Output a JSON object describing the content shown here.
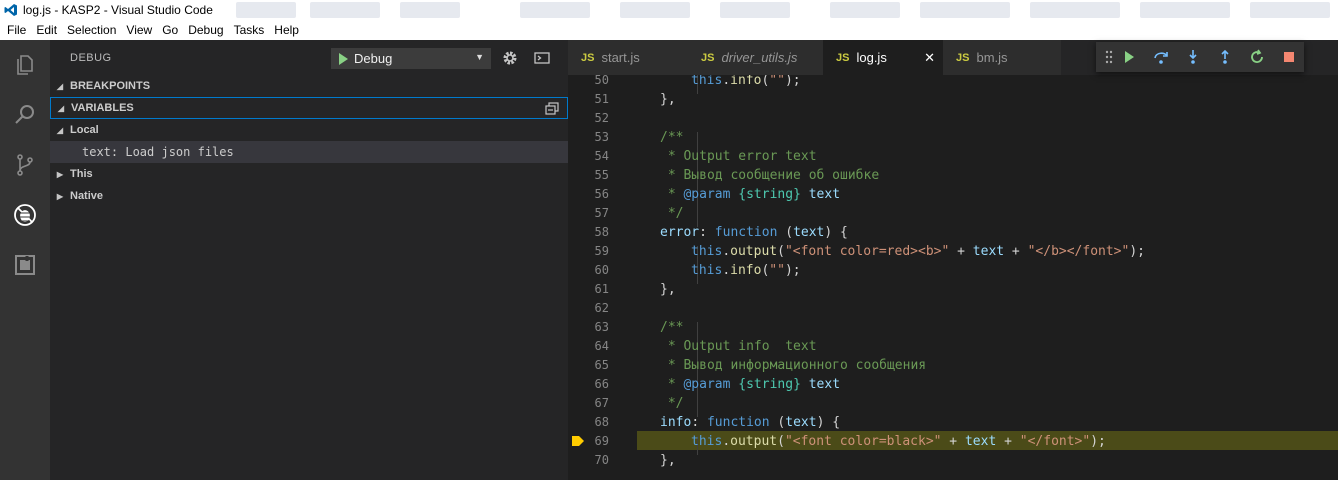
{
  "window": {
    "title": "log.js - KASP2 - Visual Studio Code"
  },
  "menu": [
    "File",
    "Edit",
    "Selection",
    "View",
    "Go",
    "Debug",
    "Tasks",
    "Help"
  ],
  "activity": [
    "explorer-icon",
    "search-icon",
    "source-control-icon",
    "debug-icon",
    "extensions-icon"
  ],
  "sidebar": {
    "title": "DEBUG",
    "config": "Debug",
    "sections": {
      "breakpoints": "BREAKPOINTS",
      "variables": "VARIABLES"
    },
    "scopes": {
      "local": "Local",
      "this": "This",
      "native": "Native"
    },
    "variable": "text: Load json files"
  },
  "tabs": [
    {
      "label": "start.js",
      "icon": "JS"
    },
    {
      "label": "driver_utils.js",
      "icon": "JS"
    },
    {
      "label": "log.js",
      "icon": "JS",
      "close": "✕"
    },
    {
      "label": "bm.js",
      "icon": "JS"
    }
  ],
  "debug_toolbar": [
    "grip-icon",
    "continue-icon",
    "step-over-icon",
    "step-into-icon",
    "step-out-icon",
    "restart-icon",
    "stop-icon"
  ],
  "editor": {
    "current_line": "69",
    "lines": [
      {
        "n": "50",
        "t": [
          [
            "this",
            "this"
          ],
          [
            "pl",
            "."
          ],
          [
            "fn",
            "info"
          ],
          [
            "pl",
            "("
          ],
          [
            "str",
            "\"\""
          ],
          [
            "pl",
            ");"
          ]
        ],
        "indent": 2
      },
      {
        "n": "51",
        "t": [
          [
            "pl",
            "},"
          ]
        ],
        "indent": 1
      },
      {
        "n": "52",
        "t": [],
        "indent": 0
      },
      {
        "n": "53",
        "t": [
          [
            "cm",
            "/**"
          ]
        ],
        "indent": 1
      },
      {
        "n": "54",
        "t": [
          [
            "cm",
            " * Output error text"
          ]
        ],
        "indent": 1
      },
      {
        "n": "55",
        "t": [
          [
            "cm",
            " * Вывод сообщение об ошибке"
          ]
        ],
        "indent": 1
      },
      {
        "n": "56",
        "t": [
          [
            "cm",
            " * "
          ],
          [
            "tag",
            "@param"
          ],
          [
            "pl",
            " "
          ],
          [
            "type",
            "{string}"
          ],
          [
            "pl",
            " "
          ],
          [
            "var",
            "text"
          ]
        ],
        "indent": 1
      },
      {
        "n": "57",
        "t": [
          [
            "cm",
            " */"
          ]
        ],
        "indent": 1
      },
      {
        "n": "58",
        "t": [
          [
            "prop",
            "error"
          ],
          [
            "pl",
            ": "
          ],
          [
            "kw",
            "function"
          ],
          [
            "pl",
            " ("
          ],
          [
            "var",
            "text"
          ],
          [
            "pl",
            ") {"
          ]
        ],
        "indent": 1
      },
      {
        "n": "59",
        "t": [
          [
            "this",
            "this"
          ],
          [
            "pl",
            "."
          ],
          [
            "fn",
            "output"
          ],
          [
            "pl",
            "("
          ],
          [
            "str",
            "\"<font color=red><b>\""
          ],
          [
            "pl",
            " + "
          ],
          [
            "var",
            "text"
          ],
          [
            "pl",
            " + "
          ],
          [
            "str",
            "\"</b></font>\""
          ],
          [
            "pl",
            ");"
          ]
        ],
        "indent": 2
      },
      {
        "n": "60",
        "t": [
          [
            "this",
            "this"
          ],
          [
            "pl",
            "."
          ],
          [
            "fn",
            "info"
          ],
          [
            "pl",
            "("
          ],
          [
            "str",
            "\"\""
          ],
          [
            "pl",
            ");"
          ]
        ],
        "indent": 2
      },
      {
        "n": "61",
        "t": [
          [
            "pl",
            "},"
          ]
        ],
        "indent": 1
      },
      {
        "n": "62",
        "t": [],
        "indent": 0
      },
      {
        "n": "63",
        "t": [
          [
            "cm",
            "/**"
          ]
        ],
        "indent": 1
      },
      {
        "n": "64",
        "t": [
          [
            "cm",
            " * Output info  text"
          ]
        ],
        "indent": 1
      },
      {
        "n": "65",
        "t": [
          [
            "cm",
            " * Вывод информационного сообщения"
          ]
        ],
        "indent": 1
      },
      {
        "n": "66",
        "t": [
          [
            "cm",
            " * "
          ],
          [
            "tag",
            "@param"
          ],
          [
            "pl",
            " "
          ],
          [
            "type",
            "{string}"
          ],
          [
            "pl",
            " "
          ],
          [
            "var",
            "text"
          ]
        ],
        "indent": 1
      },
      {
        "n": "67",
        "t": [
          [
            "cm",
            " */"
          ]
        ],
        "indent": 1
      },
      {
        "n": "68",
        "t": [
          [
            "prop",
            "info"
          ],
          [
            "pl",
            ": "
          ],
          [
            "kw",
            "function"
          ],
          [
            "pl",
            " ("
          ],
          [
            "var",
            "text"
          ],
          [
            "pl",
            ") {"
          ]
        ],
        "indent": 1
      },
      {
        "n": "69",
        "t": [
          [
            "this",
            "this"
          ],
          [
            "pl",
            "."
          ],
          [
            "fn",
            "output"
          ],
          [
            "pl",
            "("
          ],
          [
            "str",
            "\"<font color=black>\""
          ],
          [
            "pl",
            " + "
          ],
          [
            "var",
            "text"
          ],
          [
            "pl",
            " + "
          ],
          [
            "str",
            "\"</font>\""
          ],
          [
            "pl",
            ");"
          ]
        ],
        "indent": 2
      },
      {
        "n": "70",
        "t": [
          [
            "pl",
            "},"
          ]
        ],
        "indent": 1
      }
    ]
  },
  "colors": {
    "accent": "#007acc",
    "debug_line": "#4b4b18",
    "breakpoint_arrow": "#ffcc00",
    "continue": "#89d185",
    "stop": "#f48771"
  }
}
